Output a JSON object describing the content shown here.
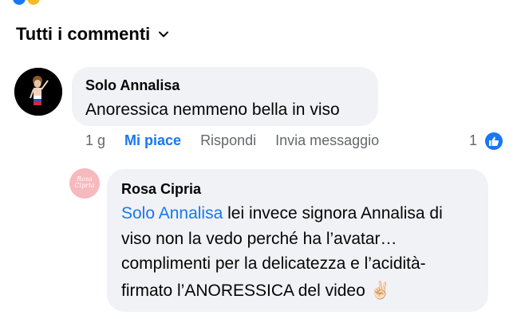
{
  "header": {
    "title": "Tutti i commenti"
  },
  "comments": [
    {
      "author": "Solo Annalisa",
      "text": "Anoressica nemmeno bella in viso",
      "time": "1 g",
      "actions": {
        "like": "Mi piace",
        "reply": "Rispondi",
        "message": "Invia messaggio"
      },
      "likes": "1"
    },
    {
      "author": "Rosa Cipria",
      "avatar_text": "Rosa Cipria",
      "mention": "Solo Annalisa",
      "line1": " lei invece signora Annalisa di",
      "line2": "viso non la vedo perché ha l’avatar…",
      "line3": "complimenti per la delicatezza e l’acidità-",
      "line4": "firmato l’ANORESSICA del video ✌🏻"
    }
  ],
  "colors": {
    "accent": "#1877f2",
    "bubble": "#f0f2f5",
    "meta": "#65676b"
  },
  "icons": [
    "chevron-down-icon",
    "like-thumb-icon"
  ]
}
